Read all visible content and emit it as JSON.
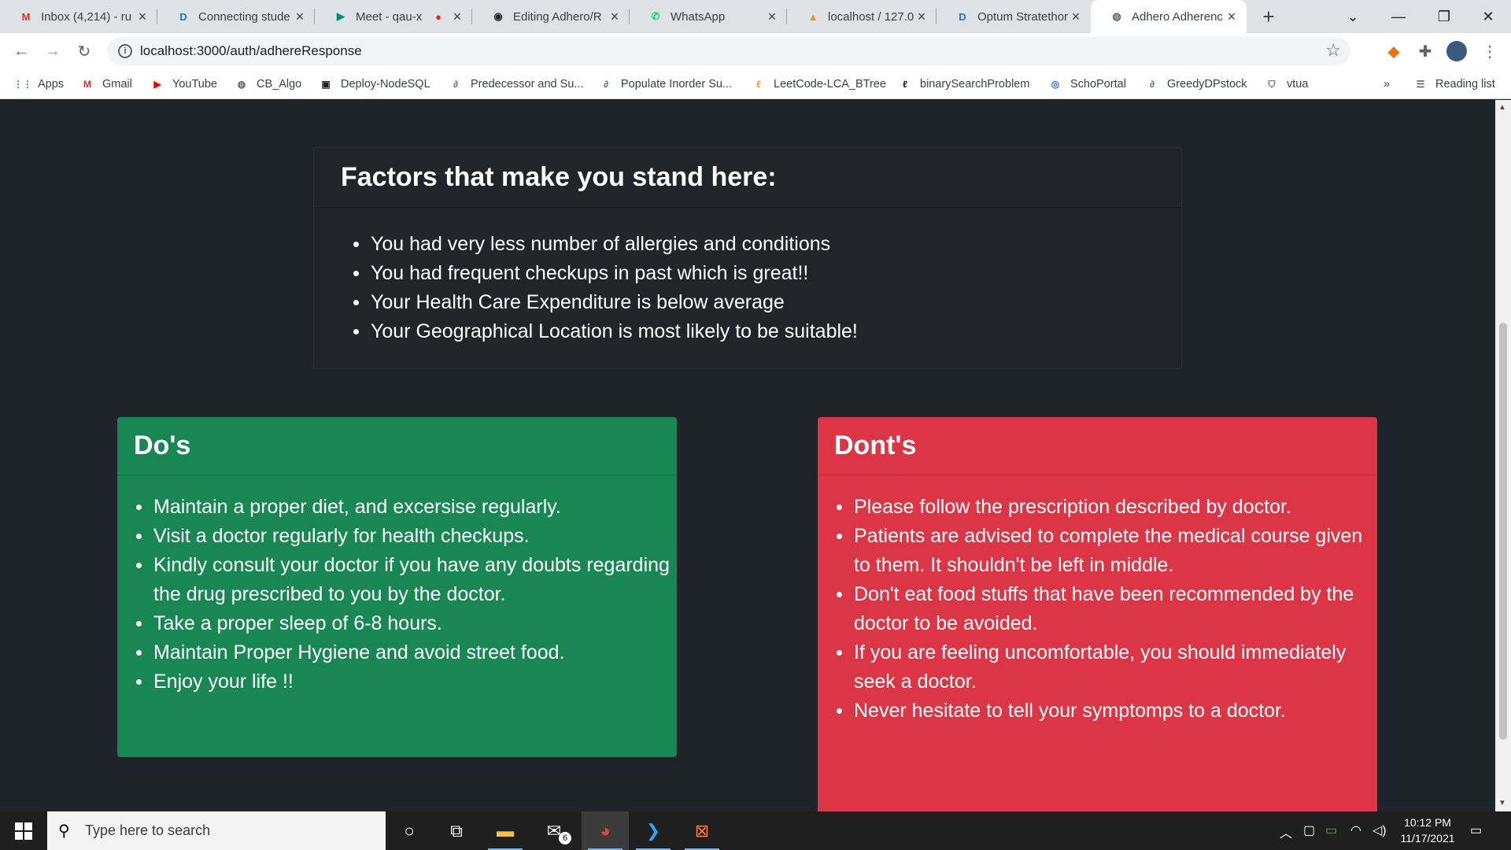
{
  "browser": {
    "tabs": [
      {
        "title": "Inbox (4,214) - ru",
        "icon": "gmail-icon"
      },
      {
        "title": "Connecting stude",
        "icon": "dc-icon"
      },
      {
        "title": "Meet - qau-x",
        "icon": "meet-icon"
      },
      {
        "title": "Editing Adhero/R",
        "icon": "github-icon"
      },
      {
        "title": "WhatsApp",
        "icon": "whatsapp-icon"
      },
      {
        "title": "localhost / 127.0.",
        "icon": "phpmyadmin-icon"
      },
      {
        "title": "Optum Stratethor",
        "icon": "dc-icon"
      },
      {
        "title": "Adhero Adherenc",
        "icon": "globe-icon"
      }
    ],
    "url": "localhost:3000/auth/adhereResponse",
    "bookmarks": [
      {
        "label": "Apps"
      },
      {
        "label": "Gmail"
      },
      {
        "label": "YouTube"
      },
      {
        "label": "CB_Algo"
      },
      {
        "label": "Deploy-NodeSQL"
      },
      {
        "label": "Predecessor and Su..."
      },
      {
        "label": "Populate Inorder Su..."
      },
      {
        "label": "LeetCode-LCA_BTree"
      },
      {
        "label": "binarySearchProblem"
      },
      {
        "label": "SchoPortal"
      },
      {
        "label": "GreedyDPstock"
      },
      {
        "label": "vtua"
      }
    ],
    "reading_list": "Reading list",
    "overflow": "»"
  },
  "page": {
    "factors": {
      "title": "Factors that make you stand here:",
      "items": [
        "You had very less number of allergies and conditions",
        "You had frequent checkups in past which is great!!",
        "Your Health Care Expenditure is below average",
        "Your Geographical Location is most likely to be suitable!"
      ]
    },
    "dos": {
      "title": "Do's",
      "items": [
        "Maintain a proper diet, and excersise regularly.",
        "Visit a doctor regularly for health checkups.",
        "Kindly consult your doctor if you have any doubts regarding the drug prescribed to you by the doctor.",
        "Take a proper sleep of 6-8 hours.",
        "Maintain Proper Hygiene and avoid street food.",
        "Enjoy your life !!"
      ]
    },
    "donts": {
      "title": "Dont's",
      "items": [
        "Please follow the prescription described by doctor.",
        "Patients are advised to complete the medical course given to them. It shouldn't be left in middle.",
        "Don't eat food stuffs that have been recommended by the doctor to be avoided.",
        "If you are feeling uncomfortable, you should immediately seek a doctor.",
        "Never hesitate to tell your symptomps to a doctor."
      ]
    }
  },
  "taskbar": {
    "search_placeholder": "Type here to search",
    "mail_badge": "6",
    "time": "10:12 PM",
    "date": "11/17/2021"
  },
  "colors": {
    "page_bg": "#1f242b",
    "dos_bg": "#198754",
    "donts_bg": "#dc3545",
    "card_bg": "#212529"
  }
}
